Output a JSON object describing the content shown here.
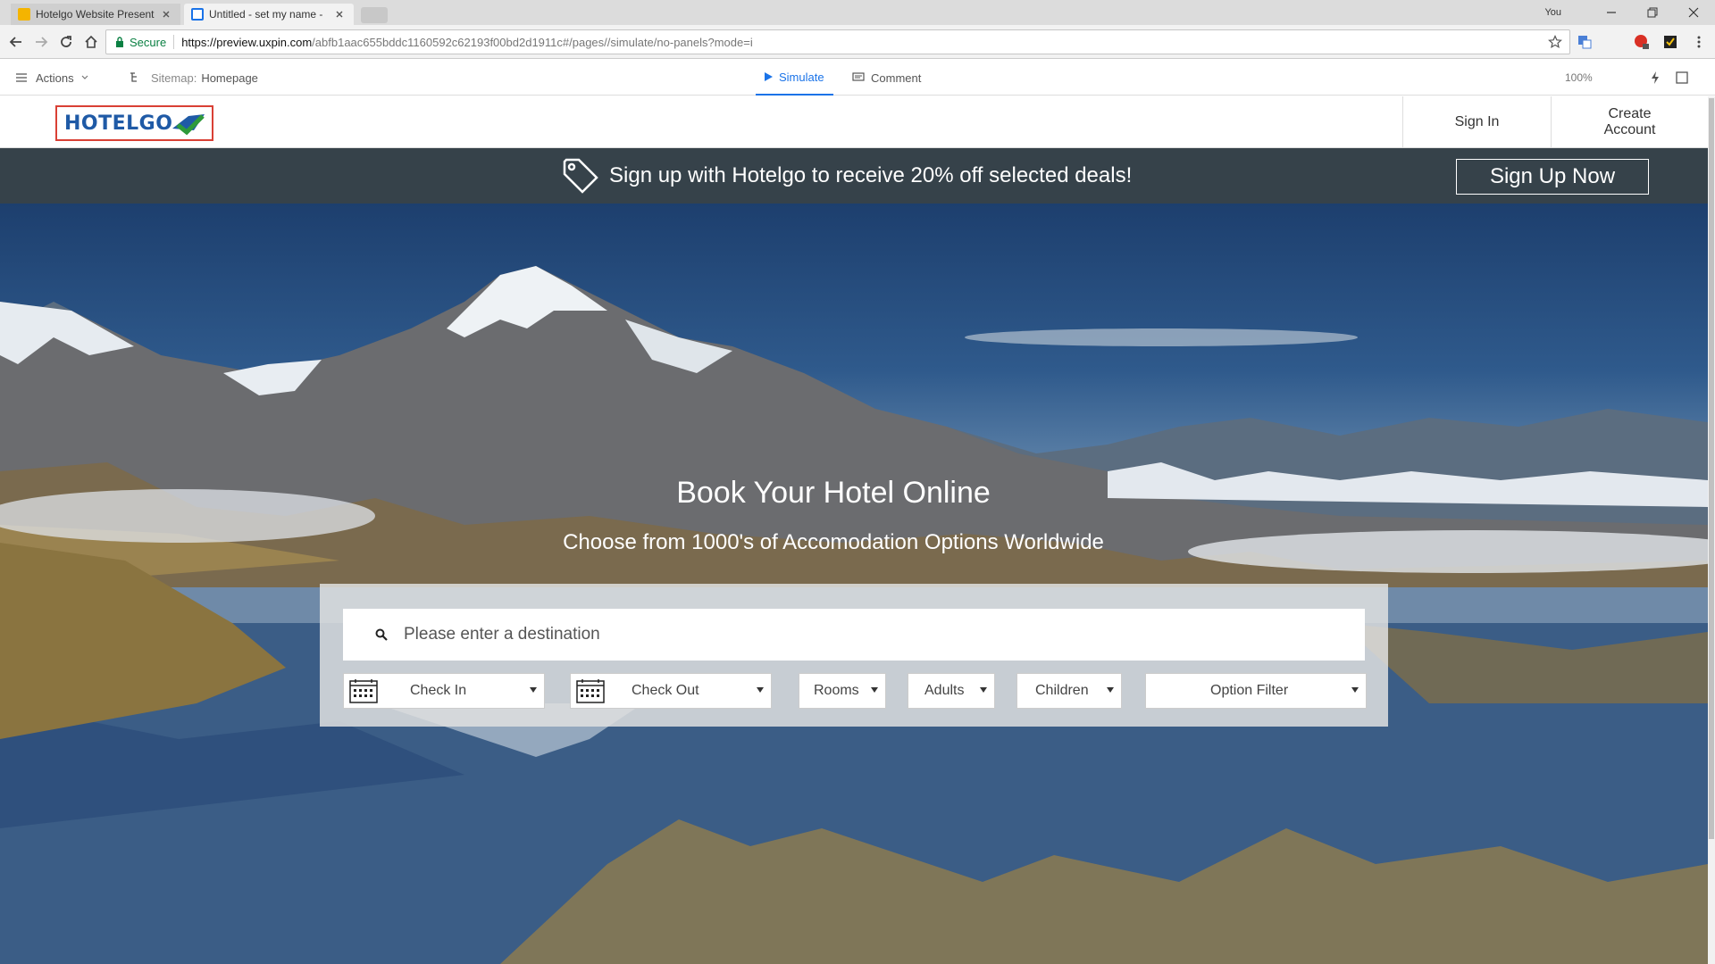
{
  "browser": {
    "tabs": [
      {
        "title": "Hotelgo Website Present",
        "favicon_color": "#f4b400",
        "active": false
      },
      {
        "title": "Untitled - set my name -",
        "favicon_color": "#1a73e8",
        "active": true
      }
    ],
    "profile_label": "You",
    "address": {
      "secure_label": "Secure",
      "url_host": "https://preview.uxpin.com",
      "url_path": "/abfb1aac655bddc1160592c62193f00bd2d1911c#/pages//simulate/no-panels?mode=i"
    }
  },
  "uxpin": {
    "actions_label": "Actions",
    "sitemap_prefix": "Sitemap:",
    "sitemap_page": "Homepage",
    "simulate_label": "Simulate",
    "comment_label": "Comment",
    "zoom": "100%"
  },
  "site": {
    "logo_text": "HOTELGO",
    "sign_in": "Sign In",
    "create_account": "Create Account",
    "promo_text": "Sign up with Hotelgo to receive 20% off selected deals!",
    "promo_button": "Sign Up Now",
    "hero_title": "Book Your Hotel Online",
    "hero_subtitle": "Choose from 1000's of Accomodation Options Worldwide",
    "destination_placeholder": "Please enter a destination",
    "filters": {
      "check_in": "Check In",
      "check_out": "Check Out",
      "rooms": "Rooms",
      "adults": "Adults",
      "children": "Children",
      "option_filter": "Option Filter"
    }
  },
  "colors": {
    "promo_bg": "#36424a",
    "logo_border": "#d94035",
    "logo_text": "#1f5aa6",
    "accent": "#1a73e8"
  }
}
